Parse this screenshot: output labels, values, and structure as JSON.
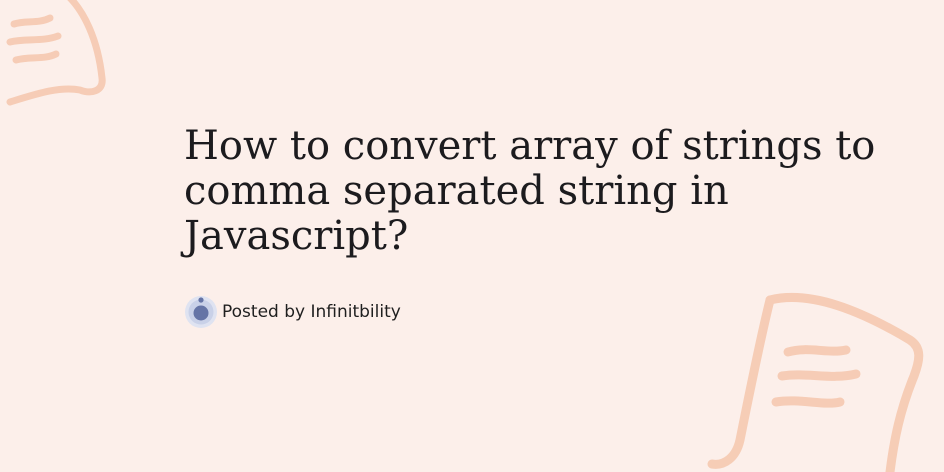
{
  "post": {
    "title": "How to convert array of strings to comma separated string in Javascript?",
    "byline": "Posted by Infinitbility"
  },
  "decorations": {
    "top_left": "scroll-doodle-icon",
    "bottom_right": "scroll-doodle-icon",
    "avatar": "infinitbility-logo-icon"
  },
  "colors": {
    "background": "#fcefea",
    "doodle": "#f5c7ad",
    "text": "#1c1b1e",
    "avatar_outer": "#c9d1e8",
    "avatar_inner": "#6574a6"
  }
}
